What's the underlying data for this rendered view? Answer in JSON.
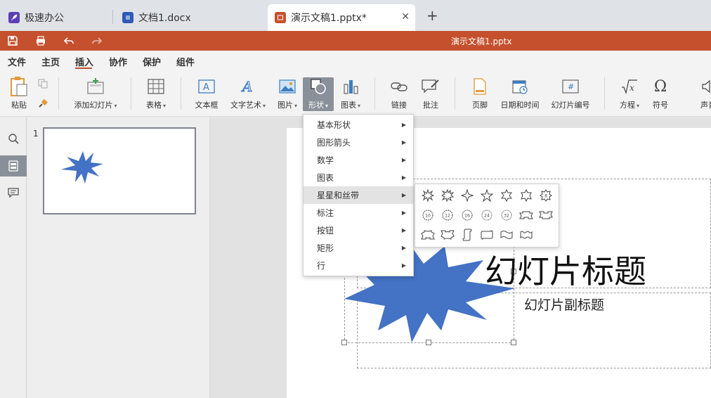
{
  "tabs": [
    {
      "label": "极速办公",
      "icon": "rocket-icon",
      "color": "#5b3fb5"
    },
    {
      "label": "文档1.docx",
      "icon": "document-icon",
      "color": "#2f5ab7"
    },
    {
      "label": "演示文稿1.pptx*",
      "icon": "presentation-icon",
      "color": "#c5502d",
      "active": true
    }
  ],
  "title_bar": {
    "doc_title": "演示文稿1.pptx",
    "color": "#c5502d"
  },
  "menu": [
    "文件",
    "主页",
    "插入",
    "协作",
    "保护",
    "组件"
  ],
  "menu_active": "插入",
  "ribbon": {
    "paste": "粘贴",
    "add_slide": "添加幻灯片",
    "table": "表格",
    "textbox": "文本框",
    "wordart": "文字艺术",
    "picture": "图片",
    "shape": "形状",
    "chart": "图表",
    "link": "链接",
    "comment": "批注",
    "footer": "页脚",
    "datetime": "日期和时间",
    "slide_number": "幻灯片编号",
    "equation": "方程",
    "symbol": "符号",
    "sound": "声音"
  },
  "thumbnails": [
    {
      "number": "1"
    }
  ],
  "slide": {
    "title": "幻灯片标题",
    "subtitle": "幻灯片副标题"
  },
  "shape_menu": [
    {
      "label": "基本形状"
    },
    {
      "label": "图形箭头"
    },
    {
      "label": "数学"
    },
    {
      "label": "图表"
    },
    {
      "label": "星星和丝带",
      "hover": true
    },
    {
      "label": "标注"
    },
    {
      "label": "按钮"
    },
    {
      "label": "矩形"
    },
    {
      "label": "行"
    }
  ],
  "star_shapes": {
    "row1": [
      "explosion-1",
      "explosion-2",
      "star-4",
      "star-5",
      "star-6",
      "star-7",
      "star-8"
    ],
    "row2": [
      "star-10",
      "star-12",
      "star-16",
      "star-24",
      "star-32",
      "ribbon-up",
      "ribbon-down"
    ],
    "row3": [
      "curved-ribbon-up",
      "curved-ribbon-down",
      "vertical-scroll",
      "horizontal-scroll",
      "wave",
      "double-wave"
    ],
    "labels": {
      "star-8": "8",
      "star-10": "10",
      "star-12": "12",
      "star-16": "16",
      "star-24": "24",
      "star-32": "32"
    }
  },
  "colors": {
    "shape_fill": "#4472c4",
    "accent": "#c5502d"
  }
}
